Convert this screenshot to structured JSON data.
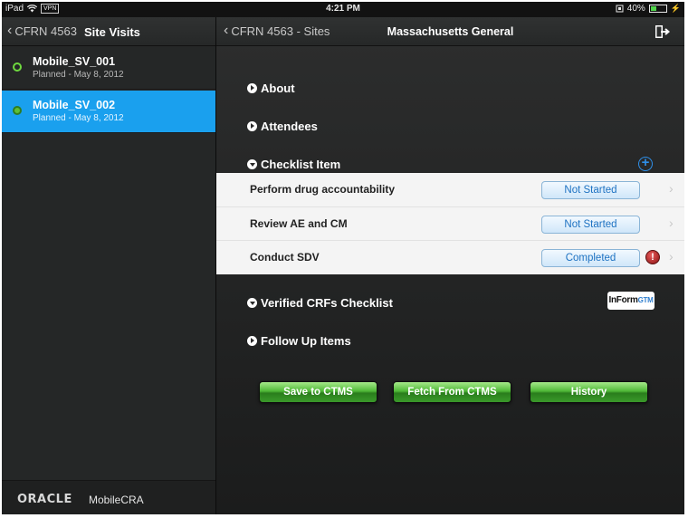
{
  "status_bar": {
    "device": "iPad",
    "vpn_badge": "VPN",
    "time": "4:21 PM",
    "battery_percent": "40%",
    "battery_level": 0.4,
    "battery_color": "#4fd34a"
  },
  "left_nav": {
    "back_label": "CFRN 4563",
    "title": "Site Visits"
  },
  "visits": [
    {
      "name": "Mobile_SV_001",
      "subtitle": "Planned - May 8, 2012",
      "selected": false
    },
    {
      "name": "Mobile_SV_002",
      "subtitle": "Planned - May 8, 2012",
      "selected": true
    }
  ],
  "footer": {
    "brand": "ORACLE",
    "product": "MobileCRA"
  },
  "right_nav": {
    "back_label": "CFRN 4563 - Sites",
    "title": "Massachusetts General",
    "exit_icon": "exit-icon"
  },
  "sections": {
    "about": "About",
    "attendees": "Attendees",
    "checklist": "Checklist Item",
    "verified_crfs": "Verified CRFs Checklist",
    "follow_up": "Follow Up Items"
  },
  "checklist_items": [
    {
      "label": "Perform drug accountability",
      "status": "Not Started",
      "alert": false
    },
    {
      "label": "Review AE and CM",
      "status": "Not Started",
      "alert": false
    },
    {
      "label": "Conduct SDV",
      "status": "Completed",
      "alert": true
    }
  ],
  "inform_logo": {
    "text": "InForm",
    "suffix": "GTM"
  },
  "actions": {
    "save": "Save to CTMS",
    "fetch": "Fetch From CTMS",
    "history": "History"
  },
  "colors": {
    "selection_blue": "#1aa0ee",
    "status_text_blue": "#1e72c2",
    "action_green": "#4fb837",
    "alert_red": "#c62828"
  }
}
